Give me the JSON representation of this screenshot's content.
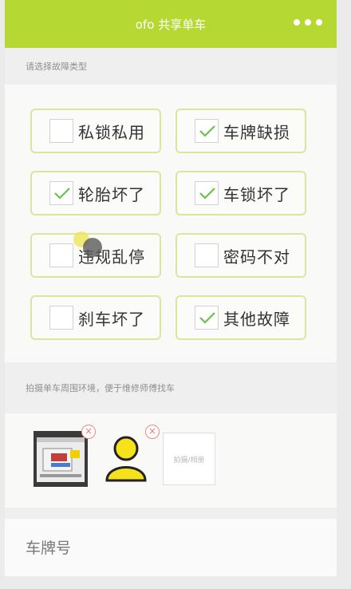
{
  "titlebar": {
    "title": "ofo 共享单车",
    "menu_icon": "more-dots-icon"
  },
  "fault_section": {
    "label": "请选择故障类型"
  },
  "options": [
    {
      "label": "私锁私用",
      "checked": false
    },
    {
      "label": "车牌缺损",
      "checked": true
    },
    {
      "label": "轮胎坏了",
      "checked": true
    },
    {
      "label": "车锁坏了",
      "checked": true
    },
    {
      "label": "违规乱停",
      "checked": false
    },
    {
      "label": "密码不对",
      "checked": false
    },
    {
      "label": "刹车坏了",
      "checked": false
    },
    {
      "label": "其他故障",
      "checked": true
    }
  ],
  "photo_section": {
    "label": "拍摄单车周围环境，便于维修师傅找车"
  },
  "photos": {
    "add_label": "拍摄/相册"
  },
  "plate": {
    "placeholder": "车牌号"
  },
  "colors": {
    "accent": "#b5d832",
    "check": "#6bbf4c",
    "delete": "#e77777"
  }
}
